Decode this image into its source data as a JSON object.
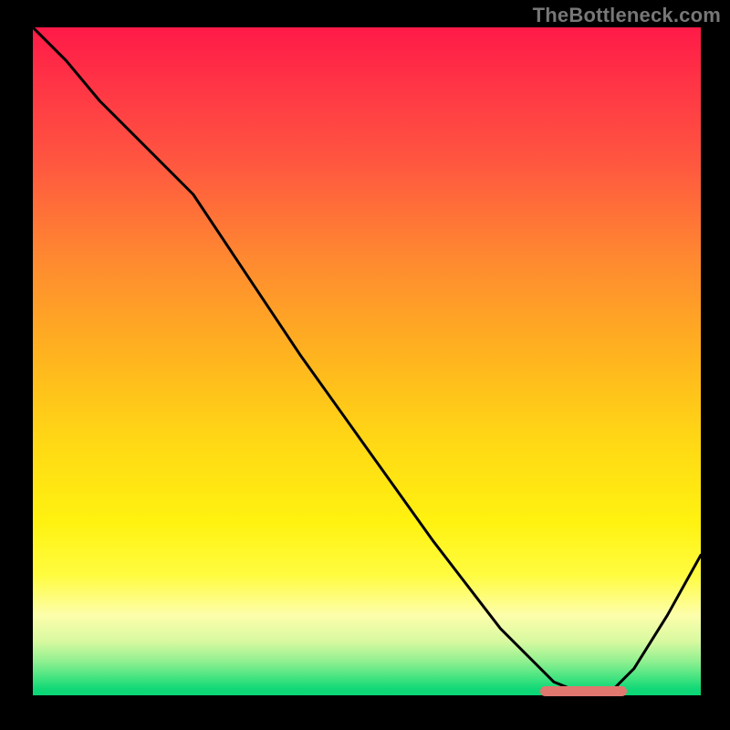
{
  "watermark": "TheBottleneck.com",
  "chart_data": {
    "type": "line",
    "title": "",
    "xlabel": "",
    "ylabel": "",
    "xlim": [
      0,
      100
    ],
    "ylim": [
      0,
      100
    ],
    "x": [
      0,
      5,
      10,
      15,
      20,
      24,
      30,
      40,
      50,
      60,
      70,
      78,
      83,
      86,
      90,
      95,
      100
    ],
    "y": [
      100,
      95,
      89,
      84,
      79,
      75,
      66,
      51,
      37,
      23,
      10,
      2,
      0,
      0,
      4,
      12,
      21
    ],
    "gradient_note": "vertical from red (top) to green (bottom)",
    "marker": {
      "x_start": 76,
      "x_end": 89,
      "y": 0.7,
      "color": "#e07870"
    }
  }
}
